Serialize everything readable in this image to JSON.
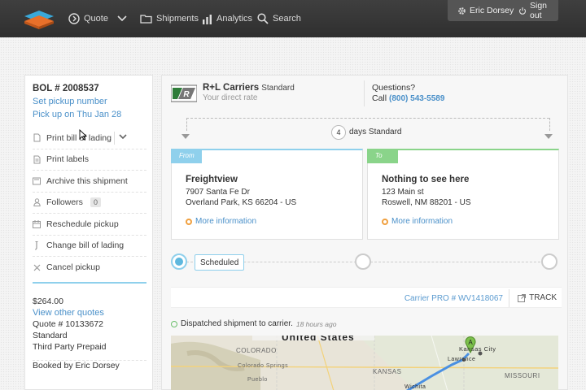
{
  "nav": {
    "quote": "Quote",
    "shipments": "Shipments",
    "analytics": "Analytics",
    "search": "Search",
    "user_name": "Eric Dorsey",
    "sign_out": "Sign out"
  },
  "left": {
    "bol": "BOL # 2008537",
    "set_pickup": "Set pickup number",
    "pickup_date": "Pick up on Thu Jan 28",
    "actions": [
      "Print bill of lading",
      "Print labels",
      "Archive this shipment",
      "Followers",
      "Reschedule pickup",
      "Change bill of lading",
      "Cancel pickup"
    ],
    "followers_count": "0",
    "price": "$264.00",
    "view_other_quotes": "View other quotes",
    "quote_number": "Quote # 10133672",
    "service": "Standard",
    "payment": "Third Party Prepaid",
    "booked_by": "Booked by Eric Dorsey"
  },
  "carrier": {
    "name": "R+L Carriers",
    "service": "Standard",
    "rate_label": "Your direct rate",
    "questions": "Questions?",
    "call_label": "Call",
    "phone": "(800) 543-5589"
  },
  "transit": {
    "days": "4",
    "label": "days Standard"
  },
  "from": {
    "tag": "From",
    "name": "Freightview",
    "street": "7907 Santa Fe Dr",
    "city": "Overland Park, KS 66204 - US",
    "more": "More information"
  },
  "to": {
    "tag": "To",
    "name": "Nothing to see here",
    "street": "123 Main st",
    "city": "Roswell, NM 88201 - US",
    "more": "More information"
  },
  "status": {
    "current": "Scheduled"
  },
  "tracking": {
    "pro": "Carrier PRO # WV1418067",
    "track": "TRACK"
  },
  "event": {
    "text": "Dispatched shipment to carrier.",
    "ago": "18 hours ago"
  },
  "map": {
    "country": "United States",
    "labels": [
      "COLORADO",
      "Colorado Springs",
      "Pueblo",
      "KANSAS",
      "MISSOURI",
      "Kansas City",
      "Lawrence",
      "Wichita"
    ],
    "marker": "A"
  }
}
